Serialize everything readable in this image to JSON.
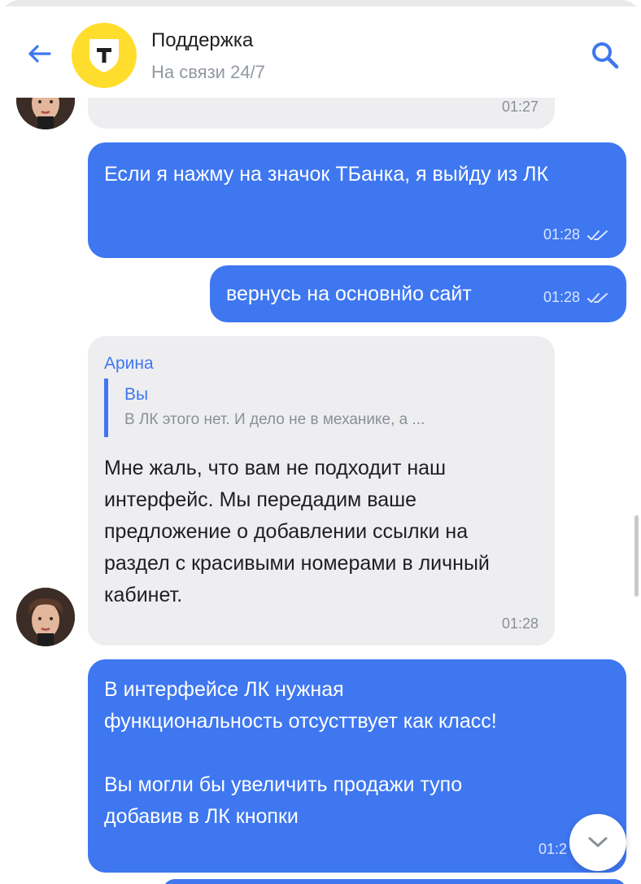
{
  "header": {
    "title": "Поддержка",
    "subtitle": "На связи 24/7",
    "logo_letter": "Т"
  },
  "messages": [
    {
      "direction": "incoming",
      "time": "01:27"
    },
    {
      "direction": "outgoing",
      "text": "Если я нажму на значок ТБанка, я выйду из ЛК",
      "time": "01:28",
      "status": "read"
    },
    {
      "direction": "outgoing",
      "text": "вернусь на основнйо сайт",
      "time": "01:28",
      "status": "read"
    },
    {
      "direction": "incoming",
      "sender": "Арина",
      "quote": {
        "author": "Вы",
        "text": "В ЛК этого нет. И дело не в механике, а ..."
      },
      "text": "Мне жаль, что вам не подходит наш интерфейс. Мы передадим ваше предложение о добавлении ссылки на раздел с красивыми номерами в личный кабинет.",
      "time": "01:28"
    },
    {
      "direction": "outgoing",
      "text_lines": [
        "В интерфейсе ЛК нужная",
        "функциональность отсусттвует как класс!",
        "",
        "Вы могли бы увеличить продажи тупо",
        "добавив в ЛК кнопки"
      ],
      "time": "01:2"
    }
  ],
  "colors": {
    "accent": "#3e77f0",
    "incoming_bg": "#eeeef1",
    "logo_yellow": "#ffdd2d"
  }
}
